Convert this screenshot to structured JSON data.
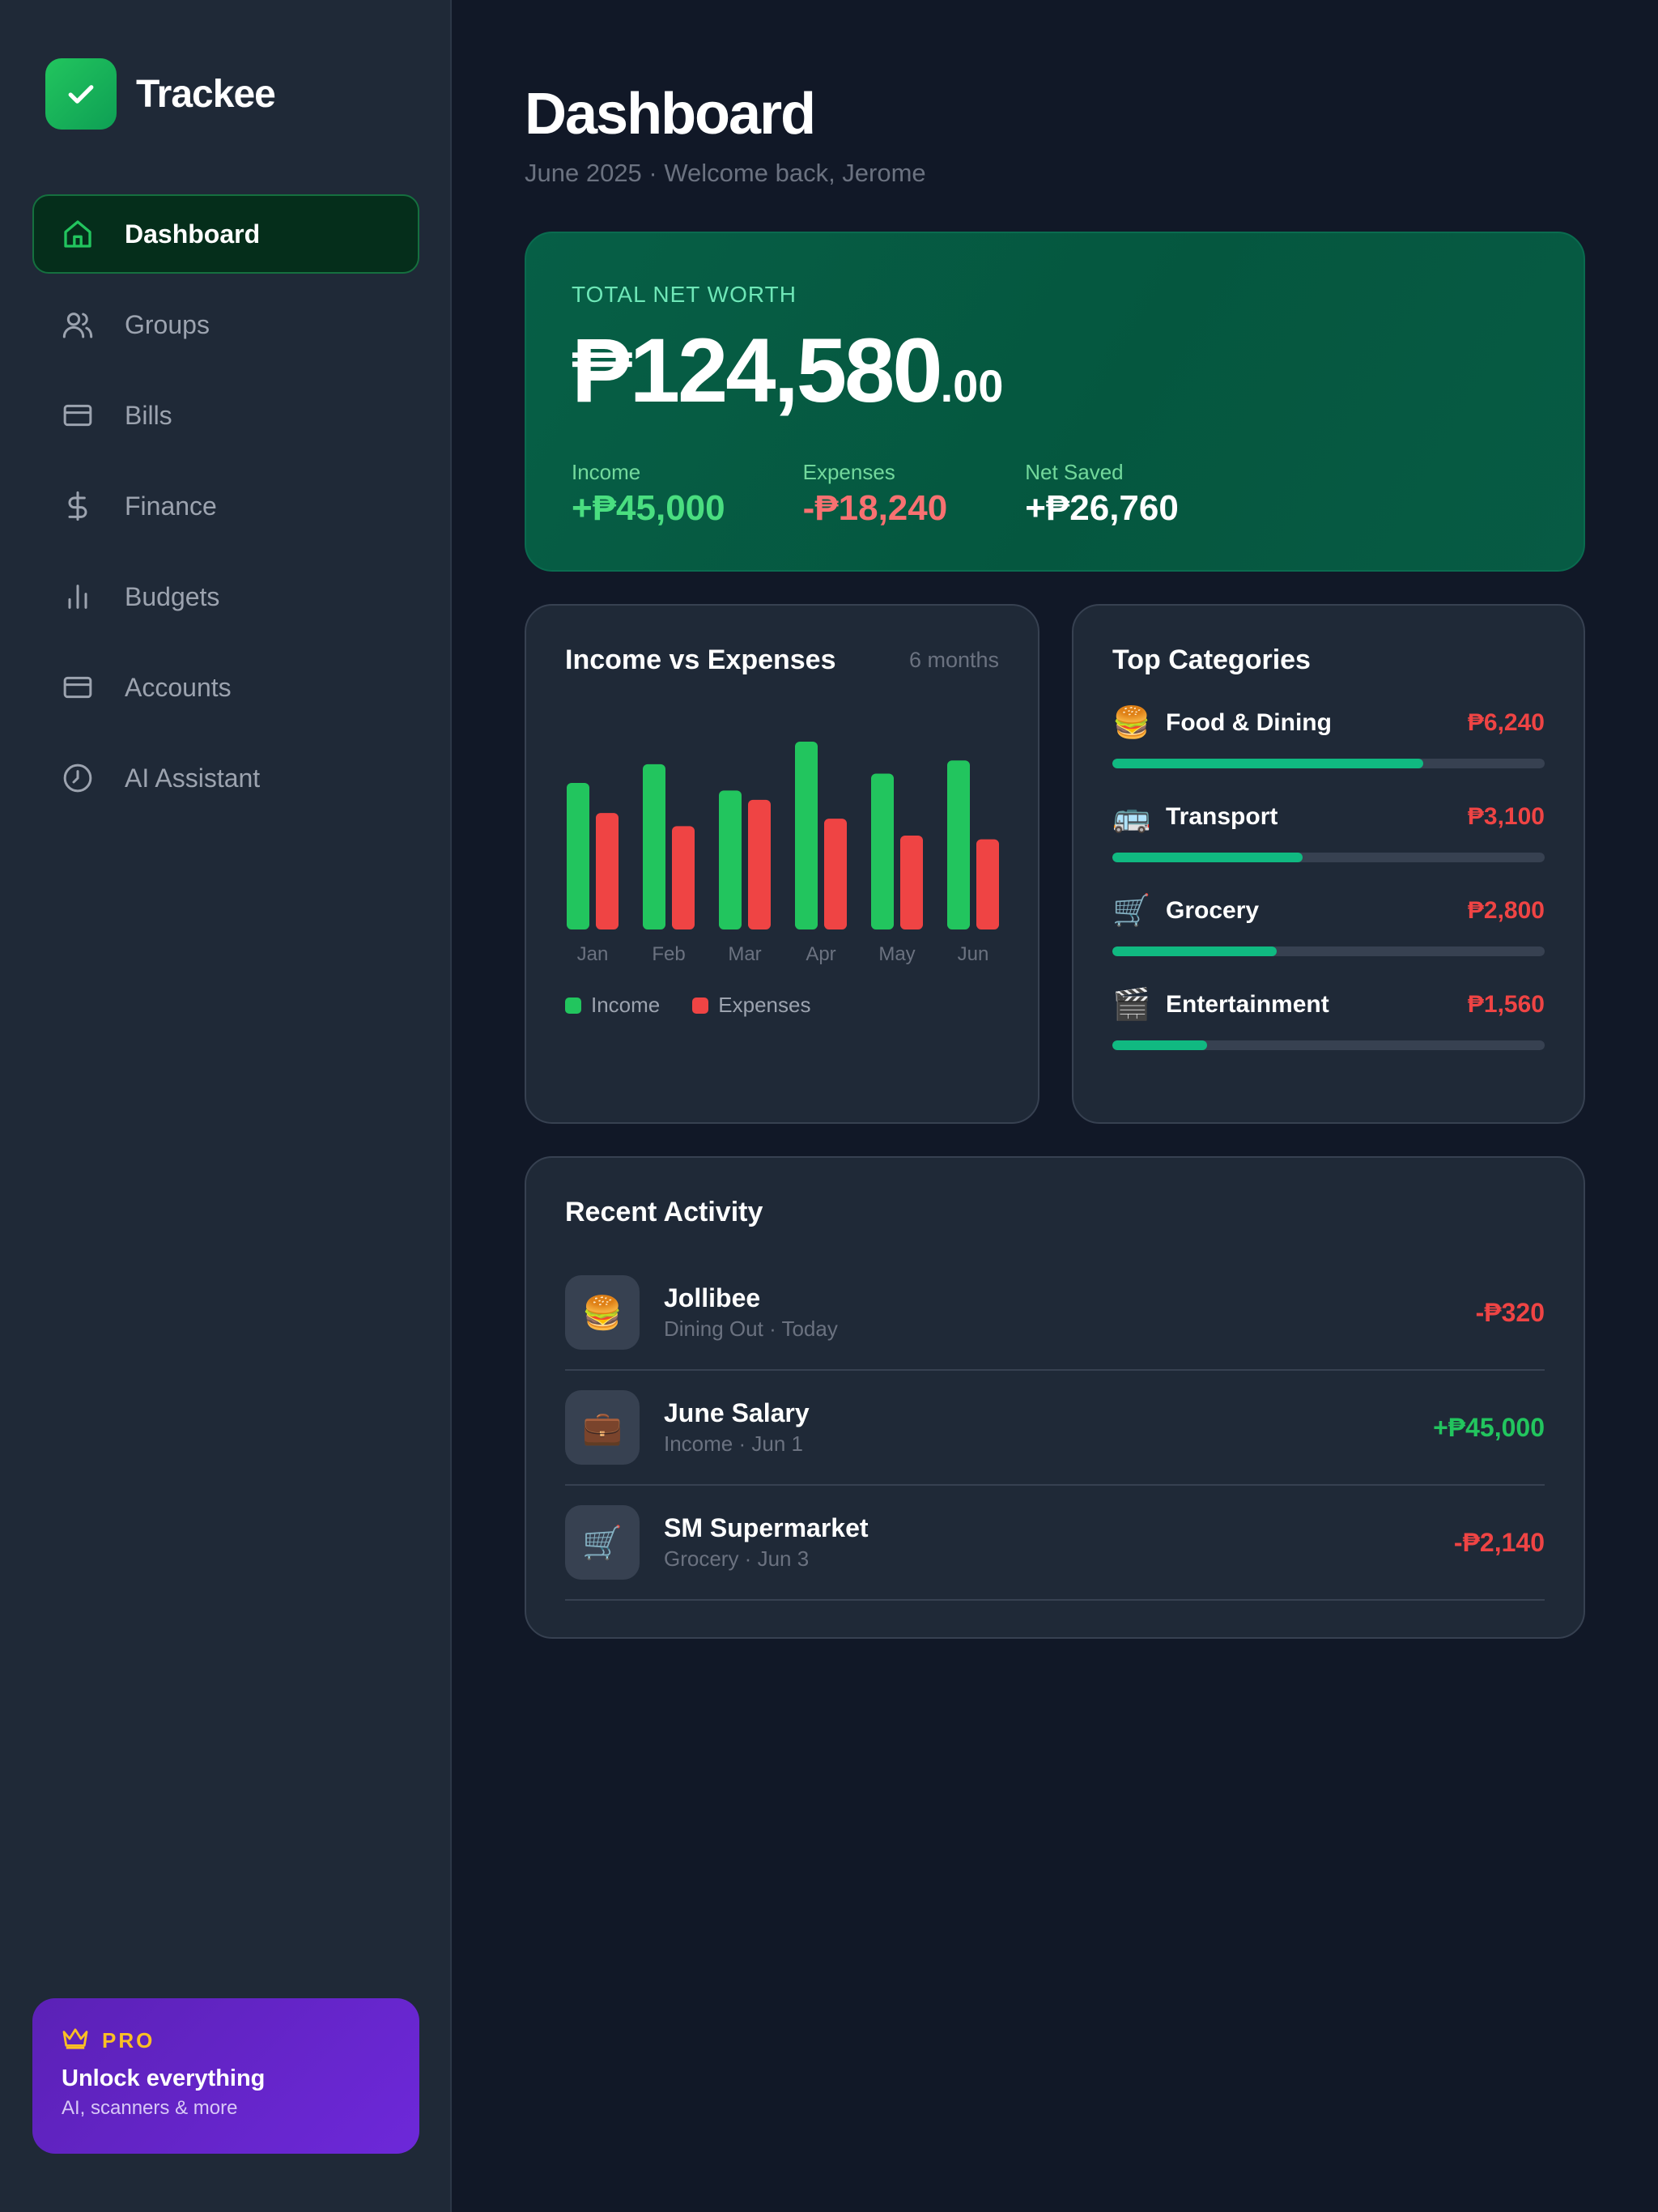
{
  "brand": {
    "name": "Trackee"
  },
  "nav": [
    {
      "label": "Dashboard",
      "icon": "home-icon",
      "active": true
    },
    {
      "label": "Groups",
      "icon": "users-icon"
    },
    {
      "label": "Bills",
      "icon": "card-icon"
    },
    {
      "label": "Finance",
      "icon": "dollar-icon"
    },
    {
      "label": "Budgets",
      "icon": "bar-chart-icon"
    },
    {
      "label": "Accounts",
      "icon": "card-icon"
    },
    {
      "label": "AI Assistant",
      "icon": "clock-icon"
    }
  ],
  "pro": {
    "badge": "PRO",
    "title": "Unlock everything",
    "subtitle": "AI, scanners & more"
  },
  "header": {
    "title": "Dashboard",
    "subtitle": "June 2025 · Welcome back, Jerome"
  },
  "net_worth": {
    "label": "TOTAL NET WORTH",
    "amount": "₱124,580",
    "cents": ".00",
    "stats": [
      {
        "label": "Income",
        "value": "+₱45,000",
        "color": "#4ade80"
      },
      {
        "label": "Expenses",
        "value": "-₱18,240",
        "color": "#f87171"
      },
      {
        "label": "Net Saved",
        "value": "+₱26,760",
        "color": "#ffffff"
      }
    ]
  },
  "chart_card": {
    "title": "Income vs Expenses",
    "range": "6 months"
  },
  "chart_data": {
    "type": "bar",
    "categories": [
      "Jan",
      "Feb",
      "Mar",
      "Apr",
      "May",
      "Jun"
    ],
    "series": [
      {
        "name": "Income",
        "color": "#22c55e",
        "values": [
          78,
          88,
          74,
          100,
          83,
          90
        ]
      },
      {
        "name": "Expenses",
        "color": "#ef4444",
        "values": [
          62,
          55,
          69,
          59,
          50,
          48
        ]
      }
    ],
    "ylim": [
      0,
      100
    ],
    "grid": false,
    "legend": "bottom-left"
  },
  "categories": {
    "title": "Top Categories",
    "items": [
      {
        "emoji": "🍔",
        "name": "Food & Dining",
        "amount": "₱6,240",
        "fraction": 0.72
      },
      {
        "emoji": "🚌",
        "name": "Transport",
        "amount": "₱3,100",
        "fraction": 0.44
      },
      {
        "emoji": "🛒",
        "name": "Grocery",
        "amount": "₱2,800",
        "fraction": 0.38
      },
      {
        "emoji": "🎬",
        "name": "Entertainment",
        "amount": "₱1,560",
        "fraction": 0.22
      }
    ]
  },
  "activity": {
    "title": "Recent Activity",
    "items": [
      {
        "emoji": "🍔",
        "name": "Jollibee",
        "meta": "Dining Out · Today",
        "amount": "-₱320",
        "color": "#ef4444"
      },
      {
        "emoji": "💼",
        "name": "June Salary",
        "meta": "Income · Jun 1",
        "amount": "+₱45,000",
        "color": "#22c55e"
      },
      {
        "emoji": "🛒",
        "name": "SM Supermarket",
        "meta": "Grocery · Jun 3",
        "amount": "-₱2,140",
        "color": "#ef4444"
      }
    ]
  }
}
